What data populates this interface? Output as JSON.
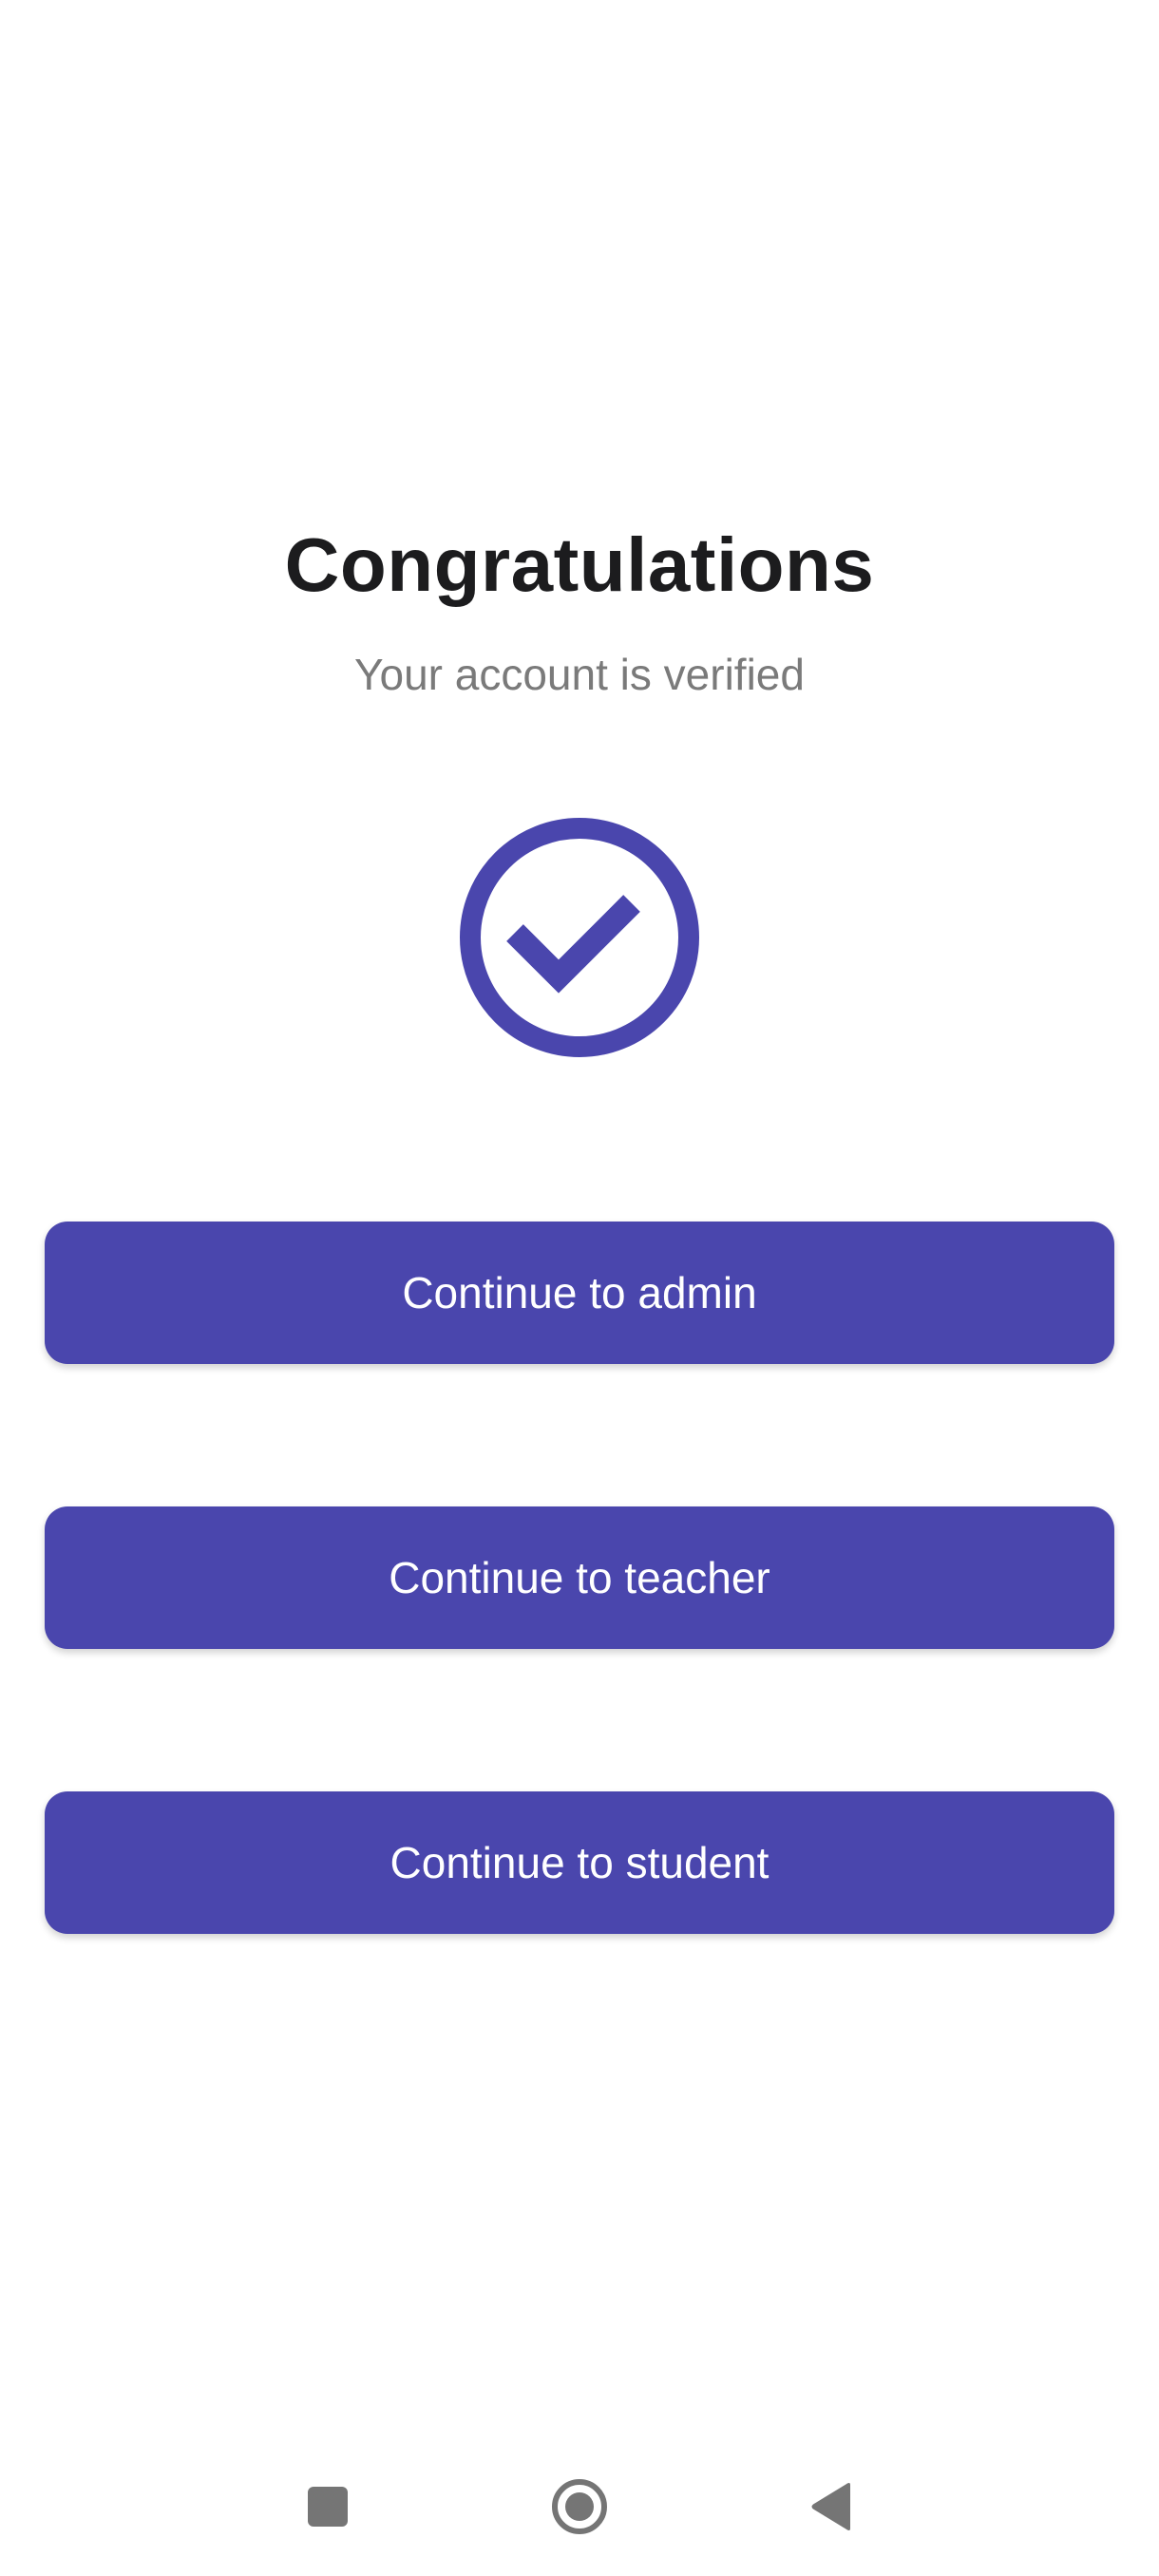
{
  "theme": {
    "accent": "#4a46ad",
    "text_primary": "#1c1c1e",
    "text_secondary": "#7a7a7a",
    "nav_icon": "#757575"
  },
  "main": {
    "title": "Congratulations",
    "subtitle": "Your account is verified",
    "status_icon": "check-circle-icon"
  },
  "actions": [
    {
      "id": "admin",
      "label": "Continue to admin"
    },
    {
      "id": "teacher",
      "label": "Continue to teacher"
    },
    {
      "id": "student",
      "label": "Continue to student"
    }
  ],
  "system_nav": {
    "recents_icon": "square-icon",
    "home_icon": "circle-icon",
    "back_icon": "triangle-back-icon"
  }
}
